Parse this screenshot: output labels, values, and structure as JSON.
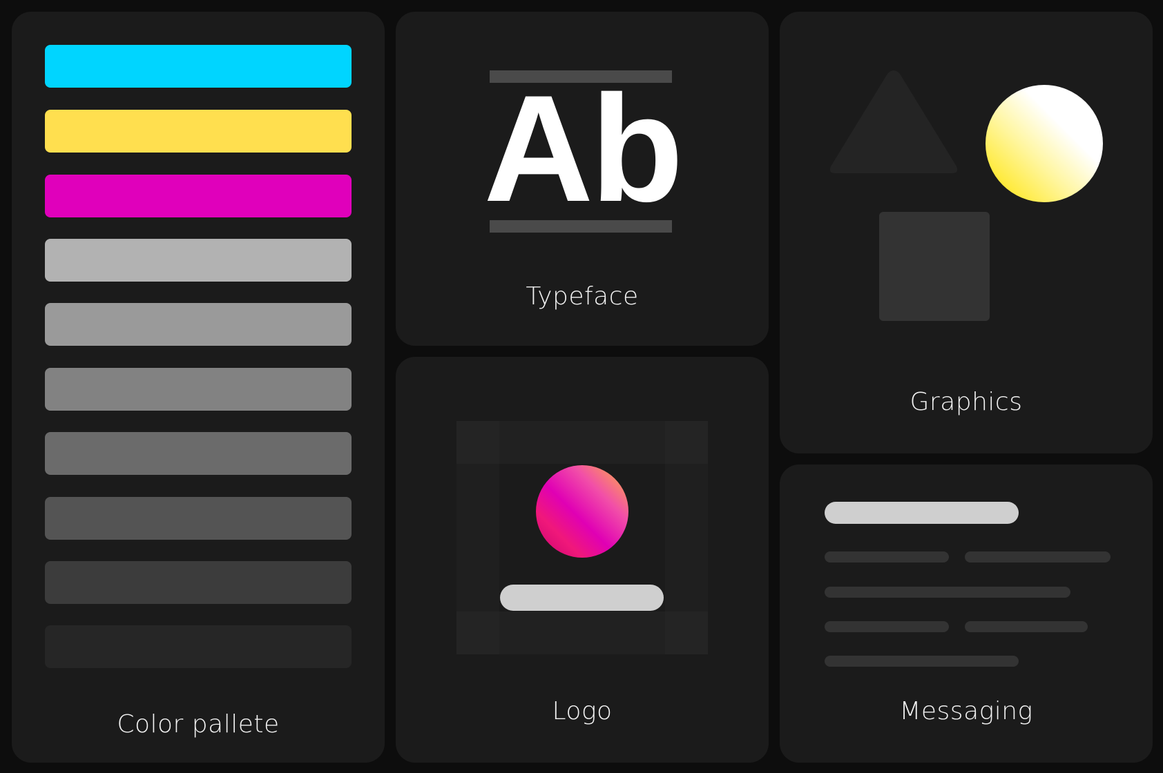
{
  "cards": {
    "palette": {
      "label": "Color pallete"
    },
    "typeface": {
      "label": "Typeface",
      "sample": "Ab"
    },
    "logo": {
      "label": "Logo"
    },
    "graphics": {
      "label": "Graphics"
    },
    "messaging": {
      "label": "Messaging"
    }
  },
  "palette_colors": [
    "#00d5ff",
    "#ffdf4f",
    "#e000bb",
    "#b2b2b2",
    "#9a9a9a",
    "#828282",
    "#6b6b6b",
    "#545454",
    "#3c3c3c",
    "#262626"
  ],
  "accent_colors": {
    "logo_gradient": [
      "#ffb53a",
      "#e000b4",
      "#c80070"
    ],
    "graphics_circle": [
      "#ffffff",
      "#ffe62c"
    ]
  }
}
